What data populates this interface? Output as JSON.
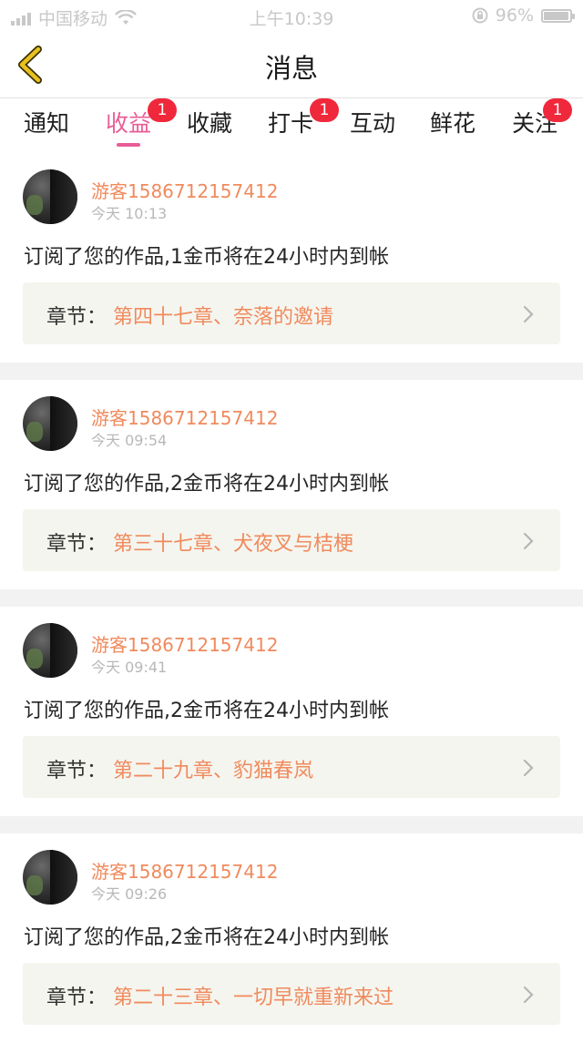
{
  "status_bar": {
    "carrier": "中国移动",
    "time": "上午10:39",
    "battery": "96%",
    "battery_level": 0.96
  },
  "nav": {
    "title": "消息"
  },
  "tabs": [
    {
      "label": "通知",
      "badge": "",
      "active": false
    },
    {
      "label": "收益",
      "badge": "1",
      "active": true
    },
    {
      "label": "收藏",
      "badge": "",
      "active": false
    },
    {
      "label": "打卡",
      "badge": "1",
      "active": false
    },
    {
      "label": "互动",
      "badge": "",
      "active": false
    },
    {
      "label": "鲜花",
      "badge": "",
      "active": false
    },
    {
      "label": "关注",
      "badge": "1",
      "active": false
    }
  ],
  "chapter_prefix": "章节：",
  "messages": [
    {
      "user": "游客1586712157412",
      "time": "今天 10:13",
      "text": "订阅了您的作品,1金币将在24小时内到帐",
      "chapter": "第四十七章、奈落的邀请"
    },
    {
      "user": "游客1586712157412",
      "time": "今天 09:54",
      "text": "订阅了您的作品,2金币将在24小时内到帐",
      "chapter": "第三十七章、犬夜叉与桔梗"
    },
    {
      "user": "游客1586712157412",
      "time": "今天 09:41",
      "text": "订阅了您的作品,2金币将在24小时内到帐",
      "chapter": "第二十九章、豹猫春岚"
    },
    {
      "user": "游客1586712157412",
      "time": "今天 09:26",
      "text": "订阅了您的作品,2金币将在24小时内到帐",
      "chapter": "第二十三章、一切早就重新来过"
    }
  ],
  "colors": {
    "accent": "#e85d96",
    "orange": "#f08a5d",
    "badge": "#f0283c",
    "back_arrow": "#e8c020"
  }
}
